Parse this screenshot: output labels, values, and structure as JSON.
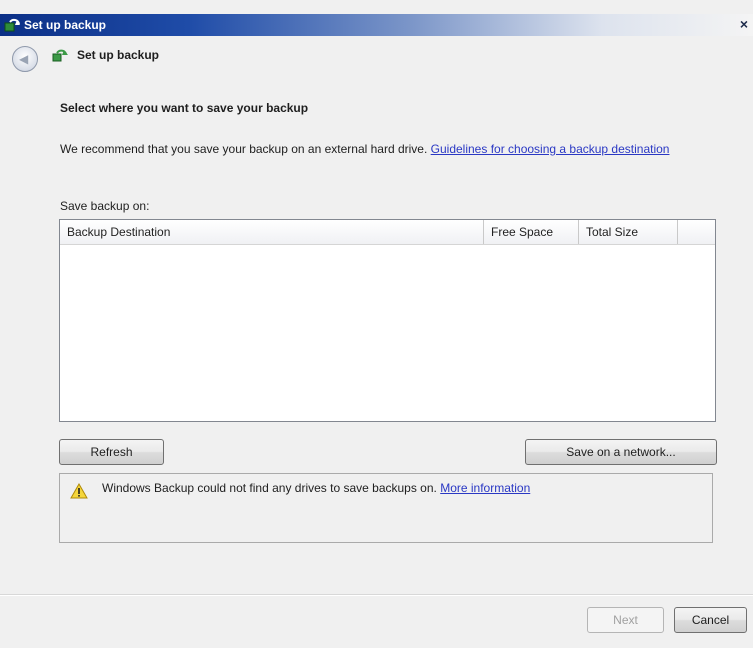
{
  "window": {
    "title": "Set up backup",
    "close_glyph": "×"
  },
  "nav": {
    "title": "Set up backup",
    "back_glyph": "◀"
  },
  "content": {
    "heading": "Select where you want to save your backup",
    "description": "We recommend that you save your backup on an external hard drive.",
    "guidelines_link": "Guidelines for choosing a backup destination",
    "save_on_label": "Save backup on:"
  },
  "list": {
    "columns": [
      "Backup Destination",
      "Free Space",
      "Total Size"
    ],
    "rows": []
  },
  "buttons": {
    "refresh": "Refresh",
    "save_network": "Save on a network...",
    "next": "Next",
    "cancel": "Cancel"
  },
  "warning": {
    "text": "Windows Backup could not find any drives to save backups on.",
    "link": "More information"
  },
  "icons": {
    "app": "backup-icon",
    "warning": "warning-icon",
    "back": "back-arrow-icon"
  },
  "colors": {
    "title_bar": "#0b2f86",
    "link": "#2a38c4",
    "background": "#f0f0f0"
  }
}
